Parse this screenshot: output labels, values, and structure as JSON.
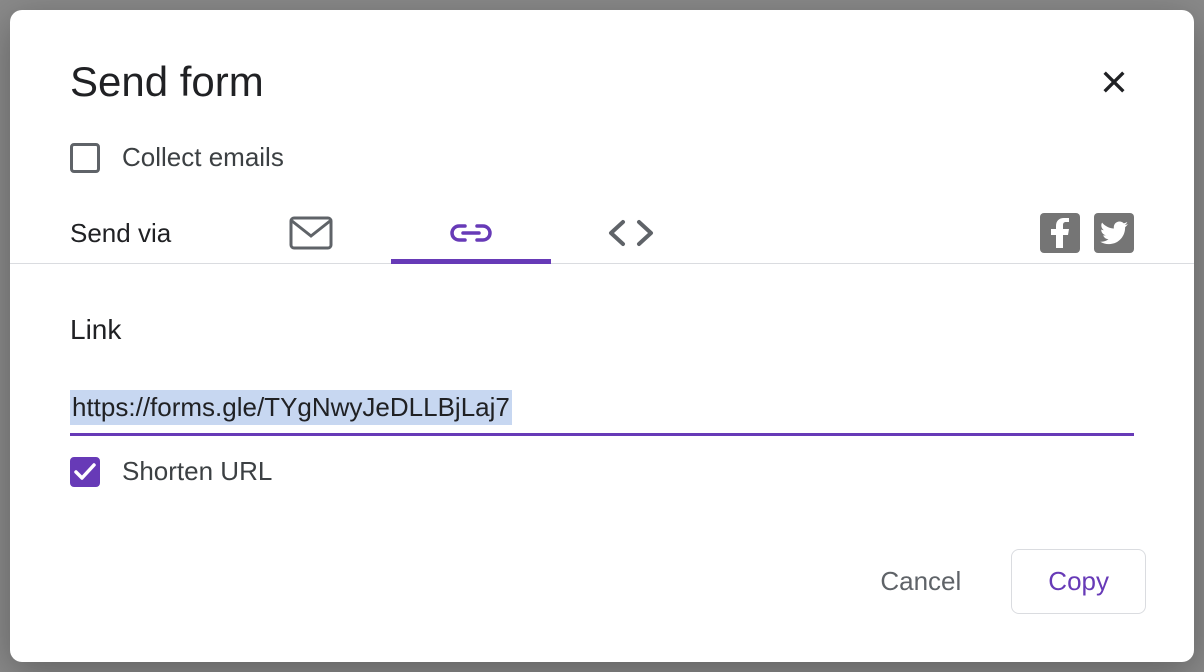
{
  "modal": {
    "title": "Send form",
    "collect_emails_label": "Collect emails",
    "collect_emails_checked": false,
    "send_via_label": "Send via",
    "tabs": {
      "active": "link"
    },
    "link_section_label": "Link",
    "link_value": "https://forms.gle/TYgNwyJeDLLBjLaj7",
    "shorten_url_label": "Shorten URL",
    "shorten_url_checked": true,
    "cancel_label": "Cancel",
    "copy_label": "Copy"
  },
  "colors": {
    "accent": "#673ab7"
  }
}
